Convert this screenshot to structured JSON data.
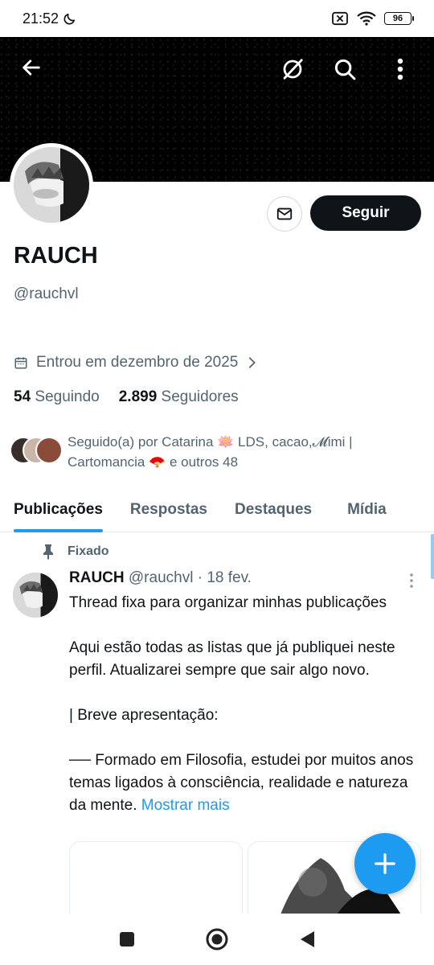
{
  "status_bar": {
    "time": "21:52",
    "battery": "96",
    "icons": [
      "moon-icon",
      "sim-off-icon",
      "wifi-icon",
      "battery-icon"
    ]
  },
  "header": {
    "back_icon": "arrow-left-icon",
    "actions": [
      "grok-icon",
      "search-icon",
      "more-vertical-icon"
    ]
  },
  "profile": {
    "display_name": "RAUCH",
    "handle": "@rauchvl",
    "joined": "Entrou em dezembro de 2025",
    "following_count": "54",
    "following_label": "Seguindo",
    "followers_count": "2.899",
    "followers_label": "Seguidores",
    "followed_by": "Seguido(a) por Catarina 🪷 LDS, cacao,𝓜imi | Cartomancia 🪭 e outros 48",
    "follow_button": "Seguir",
    "message_icon": "envelope-icon"
  },
  "tabs": [
    {
      "label": "Publicações",
      "active": true
    },
    {
      "label": "Respostas",
      "active": false
    },
    {
      "label": "Destaques",
      "active": false
    },
    {
      "label": "Mídia",
      "active": false
    }
  ],
  "pinned_tweet": {
    "pinned_label": "Fixado",
    "author_name": "RAUCH",
    "author_handle": "@rauchvl",
    "separator": "·",
    "date": "18 fev.",
    "paragraphs": [
      "Thread fixa para organizar minhas publicações",
      "Aqui estão todas as listas que já publiquei neste perfil. Atualizarei sempre que sair algo novo.",
      "| Breve apresentação:",
      "── Formado em Filosofia, estudei por muitos anos temas ligados à consciência, realidade e natureza da mente."
    ],
    "show_more": "Mostrar mais"
  },
  "fab_icon": "plus-icon",
  "nav_bar": [
    "square-icon",
    "circle-home-icon",
    "triangle-back-icon"
  ],
  "colors": {
    "accent": "#1d9bf0",
    "text_primary": "#0f1419",
    "text_secondary": "#536471",
    "banner": "#000000"
  }
}
